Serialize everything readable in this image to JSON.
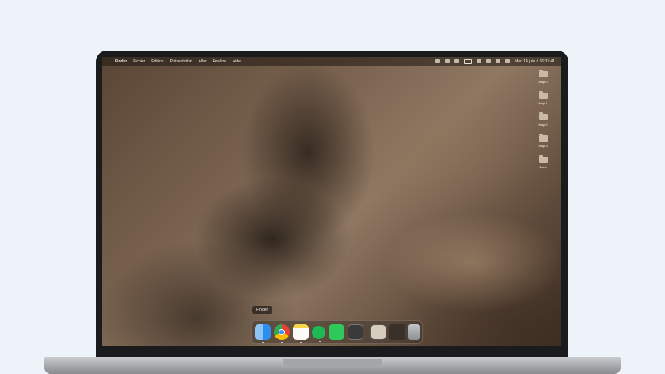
{
  "menubar": {
    "apple": "",
    "app_name": "Finder",
    "items": [
      "Fichier",
      "Edition",
      "Présentation",
      "Aller",
      "Fenêtre",
      "Aide"
    ],
    "datetime": "Mer. 14 juin à 16:37:41"
  },
  "desktop": {
    "icons": [
      "Map 0",
      "Map 1",
      "Map 2",
      "Map 3",
      "Privé"
    ]
  },
  "dock": {
    "tooltip": "Finder",
    "apps": [
      "Finder",
      "Google Chrome",
      "Notes",
      "Spotify",
      "Messages",
      "Calculator",
      "Preview",
      "Downloads",
      "Trash"
    ]
  },
  "colors": {
    "page_bg": "#eef3f9",
    "bezel": "#1b1b1d",
    "chassis": "#8a8b8e"
  }
}
